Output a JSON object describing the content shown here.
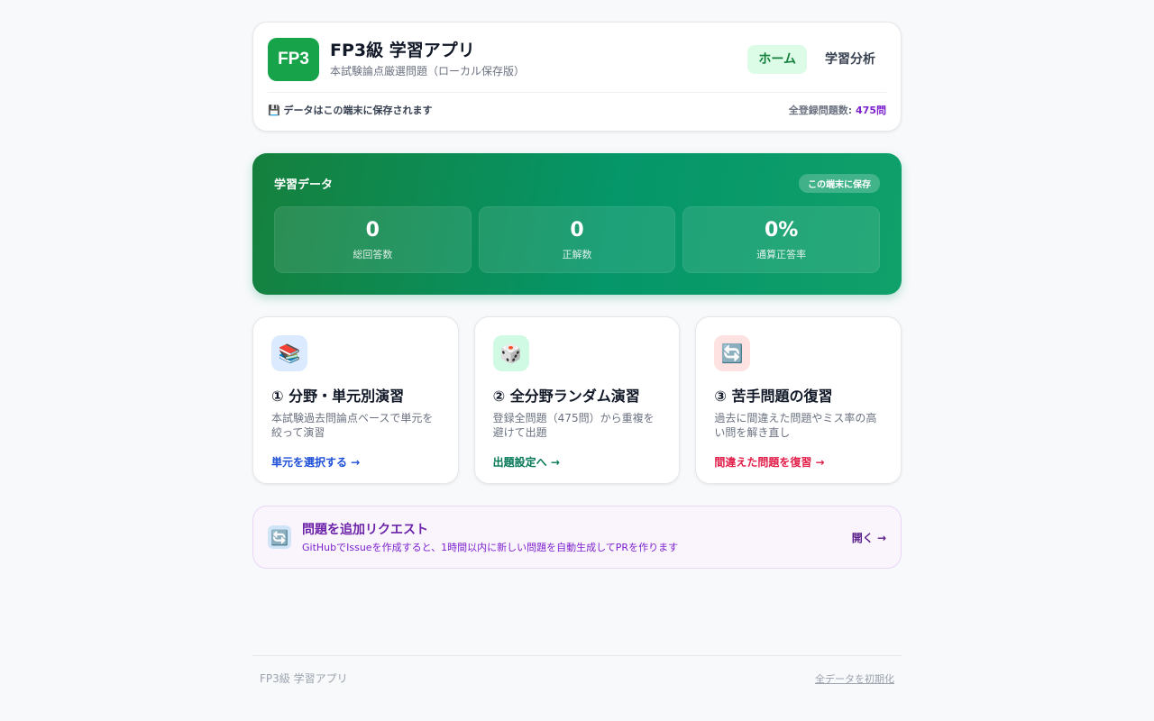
{
  "header": {
    "logo_text": "FP3",
    "title": "FP3級 学習アプリ",
    "subtitle": "本試験論点厳選問題（ローカル保存版）",
    "nav": [
      {
        "label": "ホーム",
        "active": true
      },
      {
        "label": "学習分析",
        "active": false
      }
    ],
    "storage_note": "💾 データはこの端末に保存されます",
    "count_label": "全登録問題数:",
    "count_value": "475問"
  },
  "stats": {
    "title": "学習データ",
    "badge": "この端末に保存",
    "items": [
      {
        "value": "0",
        "label": "総回答数"
      },
      {
        "value": "0",
        "label": "正解数"
      },
      {
        "value": "0%",
        "label": "通算正答率"
      }
    ]
  },
  "modes": [
    {
      "icon": "books-icon",
      "glyph": "📚",
      "icon_bg": "#dbeafe",
      "title": "① 分野・単元別演習",
      "desc": "本試験過去問論点ベースで単元を絞って演習",
      "link": "単元を選択する →",
      "link_color": "#1d4ed8"
    },
    {
      "icon": "dice-icon",
      "glyph": "🎲",
      "icon_bg": "#d1fae5",
      "title": "② 全分野ランダム演習",
      "desc": "登録全問題（475問）から重複を避けて出題",
      "link": "出題設定へ →",
      "link_color": "#047857"
    },
    {
      "icon": "repeat-icon",
      "glyph": "🔄",
      "icon_bg": "#fee2e2",
      "title": "③ 苦手問題の復習",
      "desc": "過去に間違えた問題やミス率の高い問を解き直し",
      "link": "間違えた問題を復習 →",
      "link_color": "#e11d48"
    }
  ],
  "request": {
    "glyph": "🔄",
    "title": "問題を追加リクエスト",
    "subtitle": "GitHubでIssueを作成すると、1時間以内に新しい問題を自動生成してPRを作ります",
    "open": "開く →"
  },
  "footer": {
    "app_name": "FP3級 学習アプリ",
    "reset": "全データを初期化"
  }
}
